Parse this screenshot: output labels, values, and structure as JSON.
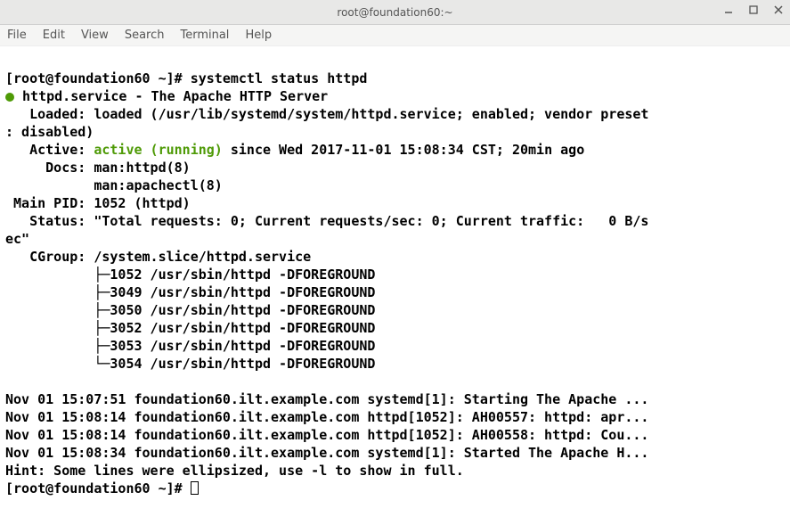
{
  "window": {
    "title": "root@foundation60:~"
  },
  "menu": {
    "file": "File",
    "edit": "Edit",
    "view": "View",
    "search": "Search",
    "terminal": "Terminal",
    "help": "Help"
  },
  "term": {
    "prompt": "[root@foundation60 ~]# ",
    "command": "systemctl status httpd",
    "service_line": " httpd.service - The Apache HTTP Server",
    "loaded_line": "   Loaded: loaded (/usr/lib/systemd/system/httpd.service; enabled; vendor preset",
    "disabled_line": ": disabled)",
    "active_label": "   Active: ",
    "active_status": "active (running)",
    "active_rest": " since Wed 2017-11-01 15:08:34 CST; 20min ago",
    "docs1": "     Docs: man:httpd(8)",
    "docs2": "           man:apachectl(8)",
    "mainpid": " Main PID: 1052 (httpd)",
    "status": "   Status: \"Total requests: 0; Current requests/sec: 0; Current traffic:   0 B/s",
    "status2": "ec\"",
    "cgroup": "   CGroup: /system.slice/httpd.service",
    "p1": "           ├─1052 /usr/sbin/httpd -DFOREGROUND",
    "p2": "           ├─3049 /usr/sbin/httpd -DFOREGROUND",
    "p3": "           ├─3050 /usr/sbin/httpd -DFOREGROUND",
    "p4": "           ├─3052 /usr/sbin/httpd -DFOREGROUND",
    "p5": "           ├─3053 /usr/sbin/httpd -DFOREGROUND",
    "p6": "           └─3054 /usr/sbin/httpd -DFOREGROUND",
    "blank": "",
    "log1": "Nov 01 15:07:51 foundation60.ilt.example.com systemd[1]: Starting The Apache ...",
    "log2": "Nov 01 15:08:14 foundation60.ilt.example.com httpd[1052]: AH00557: httpd: apr...",
    "log3": "Nov 01 15:08:14 foundation60.ilt.example.com httpd[1052]: AH00558: httpd: Cou...",
    "log4": "Nov 01 15:08:34 foundation60.ilt.example.com systemd[1]: Started The Apache H...",
    "hint": "Hint: Some lines were ellipsized, use -l to show in full.",
    "prompt2": "[root@foundation60 ~]# "
  }
}
